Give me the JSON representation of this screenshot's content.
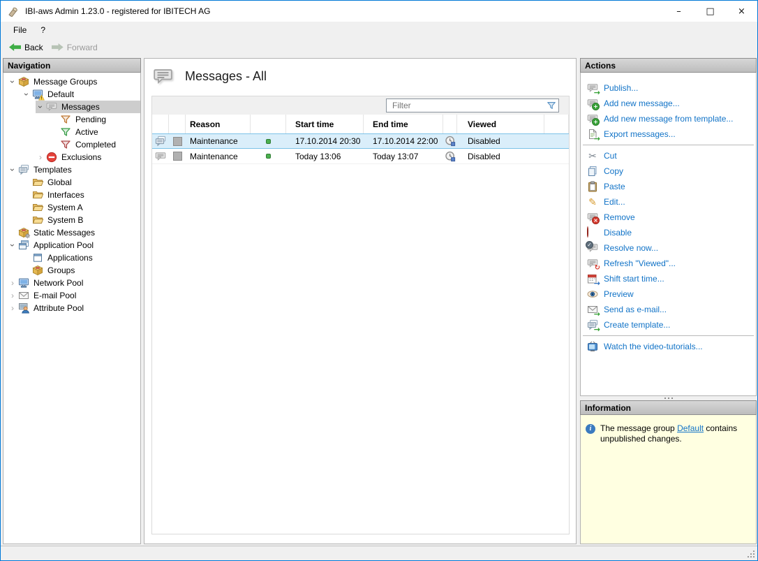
{
  "window": {
    "title": "IBI-aws Admin 1.23.0 - registered for IBITECH AG",
    "controls": {
      "minimize": "–",
      "maximize": "□",
      "close": "×"
    }
  },
  "menu": {
    "items": [
      {
        "label": "File"
      },
      {
        "label": "?"
      }
    ]
  },
  "toolbar": {
    "back": "Back",
    "forward": "Forward"
  },
  "glyphs": {
    "chevron": "›",
    "scissors": "✂",
    "pencil": "✎",
    "arrow": "→",
    "plus": "+",
    "cross": "×",
    "check": "✓",
    "refresh": "↻",
    "info": "i"
  },
  "nav": {
    "header": "Navigation",
    "items": [
      {
        "label": "Message Groups",
        "level": 0,
        "chevron": "expanded",
        "icon": "message-groups-box-icon",
        "selected": false
      },
      {
        "label": "Default",
        "level": 1,
        "chevron": "expanded",
        "icon": "monitor-warning-icon",
        "selected": false
      },
      {
        "label": "Messages",
        "level": 2,
        "chevron": "expanded",
        "icon": "message-bubble-icon",
        "selected": true
      },
      {
        "label": "Pending",
        "level": 3,
        "chevron": "none",
        "icon": "funnel-orange-icon",
        "selected": false
      },
      {
        "label": "Active",
        "level": 3,
        "chevron": "none",
        "icon": "funnel-green-icon",
        "selected": false
      },
      {
        "label": "Completed",
        "level": 3,
        "chevron": "none",
        "icon": "funnel-red-icon",
        "selected": false
      },
      {
        "label": "Exclusions",
        "level": 2,
        "chevron": "collapsed",
        "icon": "no-entry-icon",
        "selected": false
      },
      {
        "label": "Templates",
        "level": 0,
        "chevron": "expanded",
        "icon": "template-bubbles-icon",
        "selected": false
      },
      {
        "label": "Global",
        "level": 1,
        "chevron": "none",
        "icon": "folder-icon",
        "selected": false
      },
      {
        "label": "Interfaces",
        "level": 1,
        "chevron": "none",
        "icon": "folder-icon",
        "selected": false
      },
      {
        "label": "System A",
        "level": 1,
        "chevron": "none",
        "icon": "folder-icon",
        "selected": false
      },
      {
        "label": "System B",
        "level": 1,
        "chevron": "none",
        "icon": "folder-icon",
        "selected": false
      },
      {
        "label": "Static Messages",
        "level": 0,
        "chevron": "none",
        "icon": "box-gear-icon",
        "selected": false
      },
      {
        "label": "Application Pool",
        "level": 0,
        "chevron": "expanded",
        "icon": "windows-stack-icon",
        "selected": false
      },
      {
        "label": "Applications",
        "level": 1,
        "chevron": "none",
        "icon": "window-icon",
        "selected": false
      },
      {
        "label": "Groups",
        "level": 1,
        "chevron": "none",
        "icon": "groups-box-icon",
        "selected": false
      },
      {
        "label": "Network Pool",
        "level": 0,
        "chevron": "collapsed",
        "icon": "monitor-icon",
        "selected": false
      },
      {
        "label": "E-mail Pool",
        "level": 0,
        "chevron": "collapsed",
        "icon": "envelope-icon",
        "selected": false
      },
      {
        "label": "Attribute Pool",
        "level": 0,
        "chevron": "collapsed",
        "icon": "person-monitor-icon",
        "selected": false
      }
    ]
  },
  "content": {
    "title": "Messages - All",
    "filter_placeholder": "Filter",
    "table": {
      "columns": [
        "",
        "",
        "Reason",
        "",
        "Start time",
        "End time",
        "",
        "Viewed"
      ],
      "rows": [
        {
          "type_icon": "double-message-icon",
          "color_swatch": "gray",
          "reason": "Maintenance",
          "status_icon": "green-dot",
          "start": "17.10.2014 20:30",
          "end": "17.10.2014 22:00",
          "viewed_icon": "clock-icon",
          "viewed": "Disabled",
          "selected": true
        },
        {
          "type_icon": "single-message-icon",
          "color_swatch": "gray",
          "reason": "Maintenance",
          "status_icon": "green-dot",
          "start": "Today 13:06",
          "end": "Today 13:07",
          "viewed_icon": "clock-icon",
          "viewed": "Disabled",
          "selected": false
        }
      ]
    }
  },
  "actions": {
    "header": "Actions",
    "items": [
      {
        "label": "Publish...",
        "icon": "publish-icon"
      },
      {
        "label": "Add new message...",
        "icon": "add-message-icon"
      },
      {
        "label": "Add new message from template...",
        "icon": "add-message-template-icon"
      },
      {
        "label": "Export messages...",
        "icon": "export-icon"
      },
      {
        "label": "Cut",
        "icon": "scissors-icon"
      },
      {
        "label": "Copy",
        "icon": "copy-icon"
      },
      {
        "label": "Paste",
        "icon": "clipboard-icon"
      },
      {
        "label": "Edit...",
        "icon": "pencil-icon"
      },
      {
        "label": "Remove",
        "icon": "remove-icon"
      },
      {
        "label": "Disable",
        "icon": "red-dot-icon"
      },
      {
        "label": "Resolve now...",
        "icon": "resolve-icon"
      },
      {
        "label": "Refresh \"Viewed\"...",
        "icon": "refresh-viewed-icon"
      },
      {
        "label": "Shift start time...",
        "icon": "calendar-shift-icon"
      },
      {
        "label": "Preview",
        "icon": "eye-icon"
      },
      {
        "label": "Send as e-mail...",
        "icon": "send-email-icon"
      },
      {
        "label": "Create template...",
        "icon": "create-template-icon"
      },
      {
        "label": "Watch the video-tutorials...",
        "icon": "tv-icon"
      }
    ]
  },
  "information": {
    "header": "Information",
    "text_before": "The message group ",
    "link": "Default",
    "text_after": " contains unpublished changes."
  }
}
